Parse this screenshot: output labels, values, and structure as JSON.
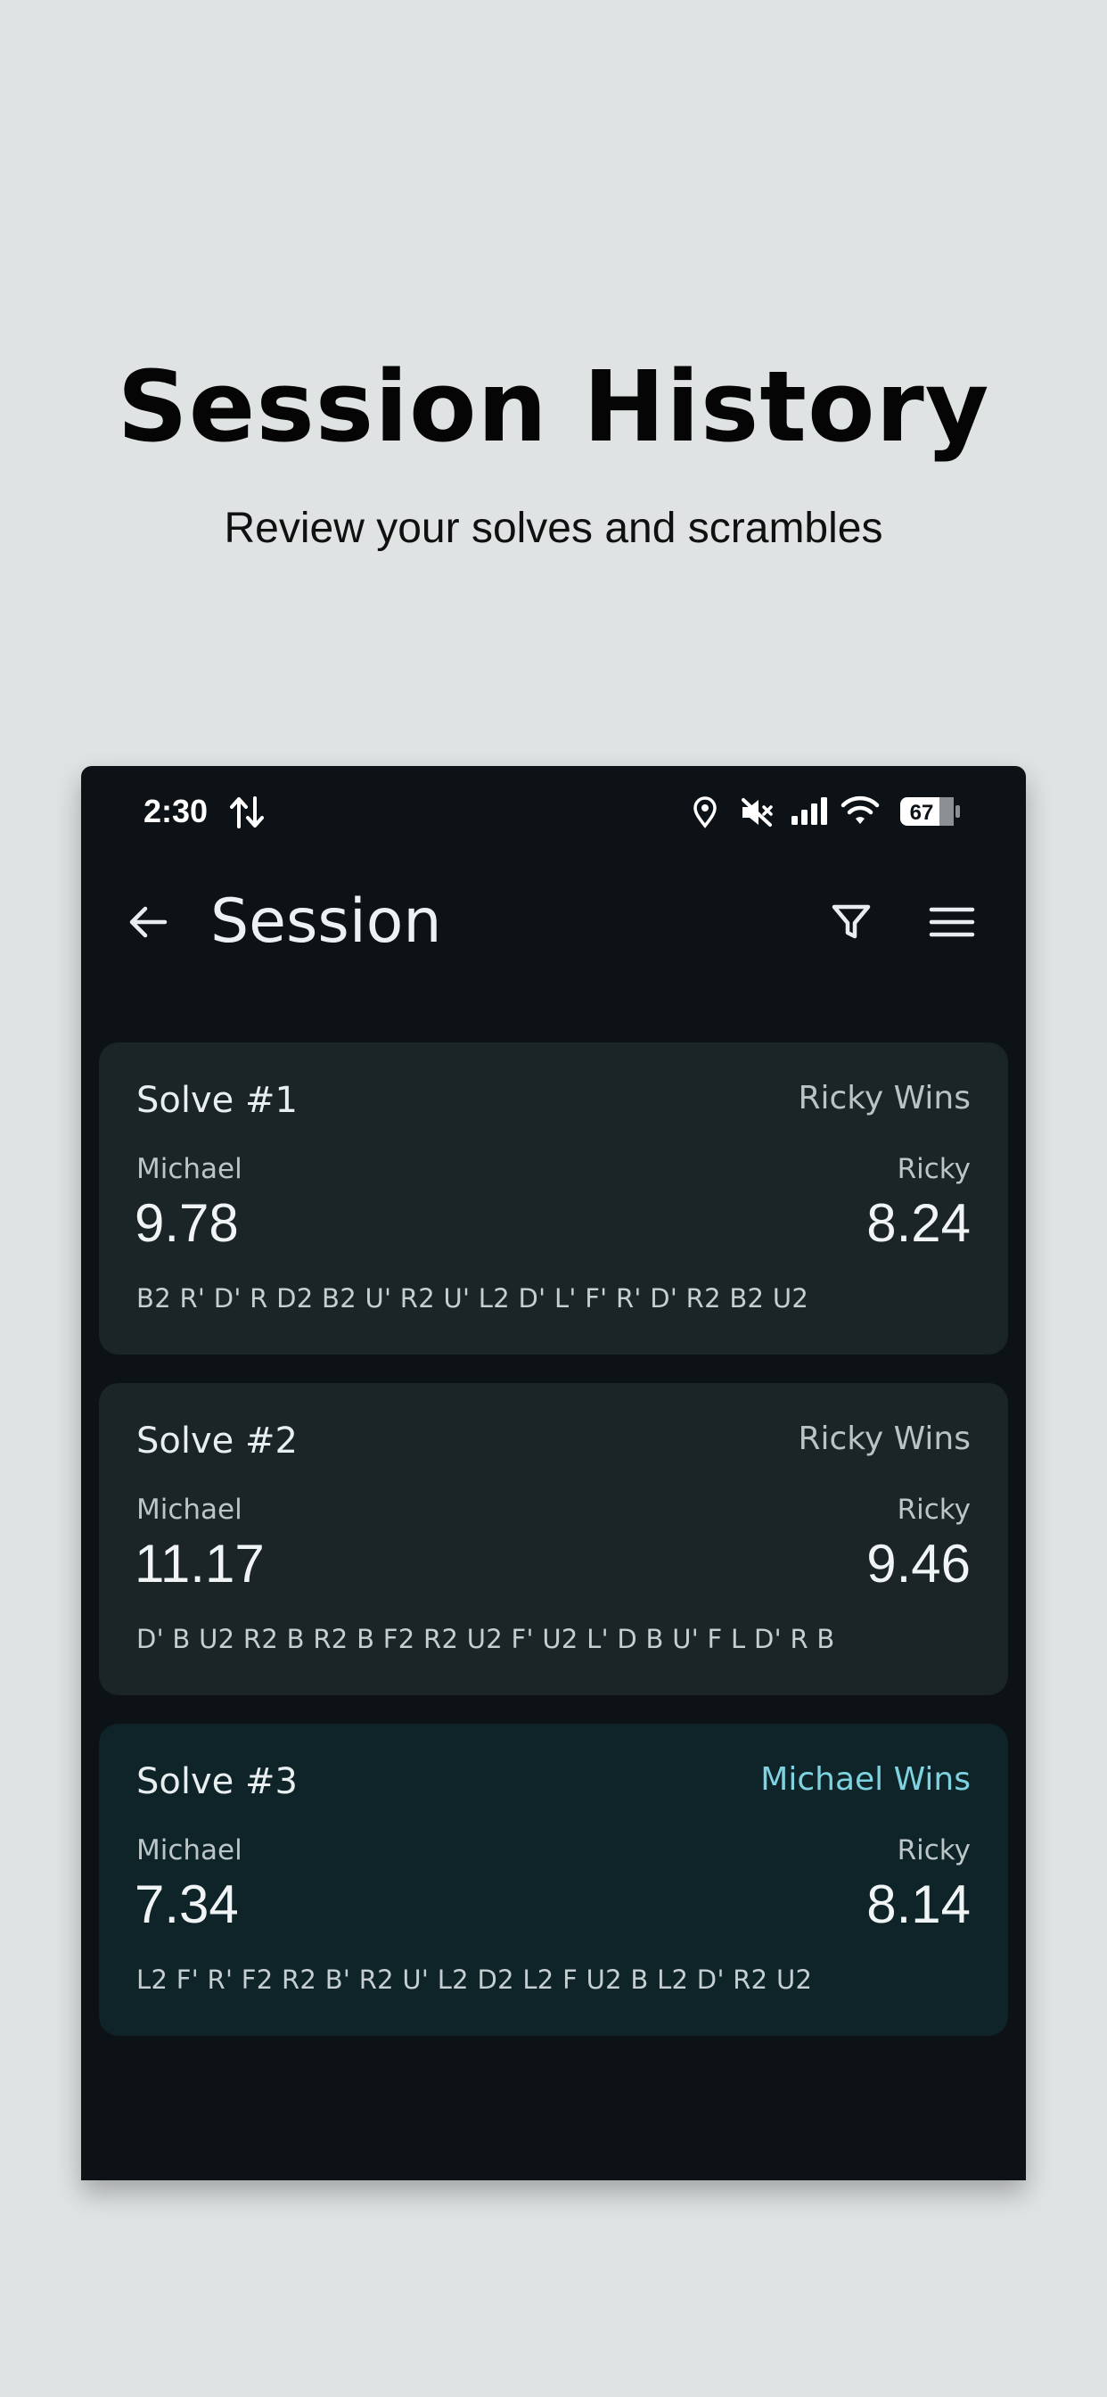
{
  "hero": {
    "title": "Session History",
    "subtitle": "Review your solves and scrambles"
  },
  "status_bar": {
    "time": "2:30",
    "battery": "67",
    "icons": [
      "data-transfer-icon",
      "location-icon",
      "mute-icon",
      "signal-icon",
      "wifi-icon",
      "battery-icon"
    ]
  },
  "app_bar": {
    "title": "Session",
    "icons": [
      "back-arrow-icon",
      "filter-icon",
      "menu-icon"
    ]
  },
  "solves": [
    {
      "title": "Solve #1",
      "result": "Ricky Wins",
      "player1": {
        "name": "Michael",
        "time": "9.78"
      },
      "player2": {
        "name": "Ricky",
        "time": "8.24"
      },
      "scramble": "B2 R' D' R D2 B2 U' R2 U' L2 D' L' F' R' D' R2 B2 U2"
    },
    {
      "title": "Solve #2",
      "result": "Ricky Wins",
      "player1": {
        "name": "Michael",
        "time": "11.17"
      },
      "player2": {
        "name": "Ricky",
        "time": "9.46"
      },
      "scramble": "D' B U2 R2 B R2 B F2 R2 U2 F' U2 L' D B U' F L D' R B"
    },
    {
      "title": "Solve #3",
      "result": "Michael Wins",
      "player1": {
        "name": "Michael",
        "time": "7.34"
      },
      "player2": {
        "name": "Ricky",
        "time": "8.14"
      },
      "scramble": "L2 F' R' F2 R2 B' R2 U' L2 D2 L2 F U2 B L2 D' R2 U2"
    }
  ],
  "colors": {
    "page_background": "#dfe3e4",
    "phone_background": "#0c1215",
    "card_background": "#1b2426",
    "card_highlight_background": "#0e2429",
    "winner_accent": "#7fd3e0"
  }
}
